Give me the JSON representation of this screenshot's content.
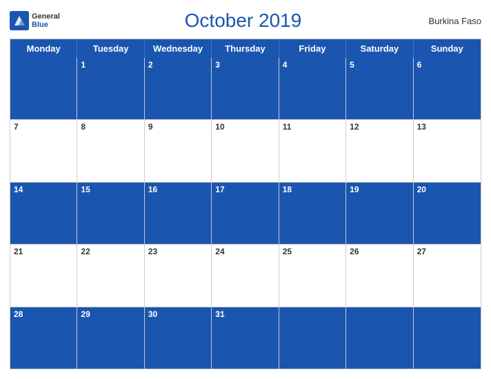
{
  "header": {
    "title": "October 2019",
    "country": "Burkina Faso",
    "logo": {
      "general": "General",
      "blue": "Blue"
    }
  },
  "days_of_week": [
    "Monday",
    "Tuesday",
    "Wednesday",
    "Thursday",
    "Friday",
    "Saturday",
    "Sunday"
  ],
  "weeks": [
    [
      {
        "num": "",
        "empty": true
      },
      {
        "num": "1"
      },
      {
        "num": "2"
      },
      {
        "num": "3"
      },
      {
        "num": "4"
      },
      {
        "num": "5"
      },
      {
        "num": "6"
      }
    ],
    [
      {
        "num": "7"
      },
      {
        "num": "8"
      },
      {
        "num": "9"
      },
      {
        "num": "10"
      },
      {
        "num": "11"
      },
      {
        "num": "12"
      },
      {
        "num": "13"
      }
    ],
    [
      {
        "num": "14"
      },
      {
        "num": "15"
      },
      {
        "num": "16"
      },
      {
        "num": "17"
      },
      {
        "num": "18"
      },
      {
        "num": "19"
      },
      {
        "num": "20"
      }
    ],
    [
      {
        "num": "21"
      },
      {
        "num": "22"
      },
      {
        "num": "23"
      },
      {
        "num": "24"
      },
      {
        "num": "25"
      },
      {
        "num": "26"
      },
      {
        "num": "27"
      }
    ],
    [
      {
        "num": "28"
      },
      {
        "num": "29"
      },
      {
        "num": "30"
      },
      {
        "num": "31"
      },
      {
        "num": "",
        "empty": true
      },
      {
        "num": "",
        "empty": true
      },
      {
        "num": "",
        "empty": true
      }
    ]
  ],
  "accent_color": "#1a56b0"
}
